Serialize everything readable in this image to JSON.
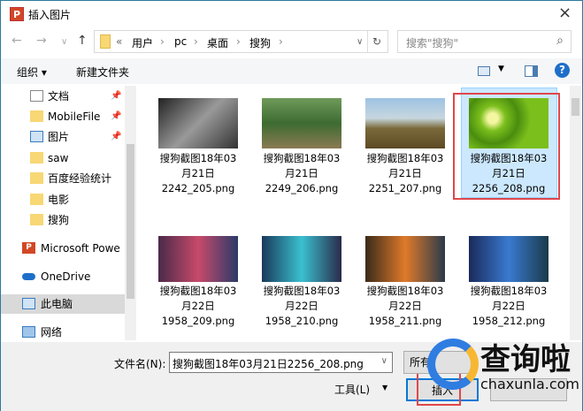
{
  "window": {
    "title": "插入图片",
    "app_icon": "powerpoint-icon",
    "close_icon": "×"
  },
  "nav": {
    "back": "←",
    "forward": "→",
    "recent": "∨",
    "up": "↑",
    "breadcrumb": [
      "«",
      "用户",
      "pc",
      "桌面",
      "搜狗"
    ],
    "separator": "›",
    "dropdown": "∨",
    "refresh": "↻",
    "search_placeholder": "搜索\"搜狗\"",
    "search_icon": "⌕"
  },
  "toolbar": {
    "organize": "组织 ▾",
    "new_folder": "新建文件夹",
    "help": "?"
  },
  "sidebar": {
    "items": [
      {
        "label": "文档",
        "pinned": true
      },
      {
        "label": "MobileFile",
        "pinned": true
      },
      {
        "label": "图片",
        "pinned": true
      },
      {
        "label": "saw"
      },
      {
        "label": "百度经验统计"
      },
      {
        "label": "电影"
      },
      {
        "label": "搜狗"
      },
      {
        "label": "Microsoft Powe"
      },
      {
        "label": "OneDrive"
      },
      {
        "label": "此电脑",
        "selected": true
      },
      {
        "label": "网络"
      }
    ]
  },
  "files": [
    {
      "l1": "搜狗截图18年03",
      "l2": "月21日",
      "l3": "2242_205.png"
    },
    {
      "l1": "搜狗截图18年03",
      "l2": "月21日",
      "l3": "2249_206.png"
    },
    {
      "l1": "搜狗截图18年03",
      "l2": "月21日",
      "l3": "2251_207.png"
    },
    {
      "l1": "搜狗截图18年03",
      "l2": "月21日",
      "l3": "2256_208.png",
      "selected": true
    },
    {
      "l1": "搜狗截图18年03",
      "l2": "月22日",
      "l3": "1958_209.png"
    },
    {
      "l1": "搜狗截图18年03",
      "l2": "月22日",
      "l3": "1958_210.png"
    },
    {
      "l1": "搜狗截图18年03",
      "l2": "月22日",
      "l3": "1958_211.png"
    },
    {
      "l1": "搜狗截图18年03",
      "l2": "月22日",
      "l3": "1958_212.png"
    }
  ],
  "bottom": {
    "filename_label": "文件名(N):",
    "filename_value": "搜狗截图18年03月21日2256_208.png",
    "filetype": "所有",
    "tools": "工具(L)",
    "insert": "插入",
    "cancel": ""
  },
  "watermark": {
    "text": "查询啦",
    "url": "chaxunla.com"
  },
  "colors": {
    "selection": "#cce8ff",
    "highlight": "#e0474c",
    "accent": "#0078d7"
  }
}
